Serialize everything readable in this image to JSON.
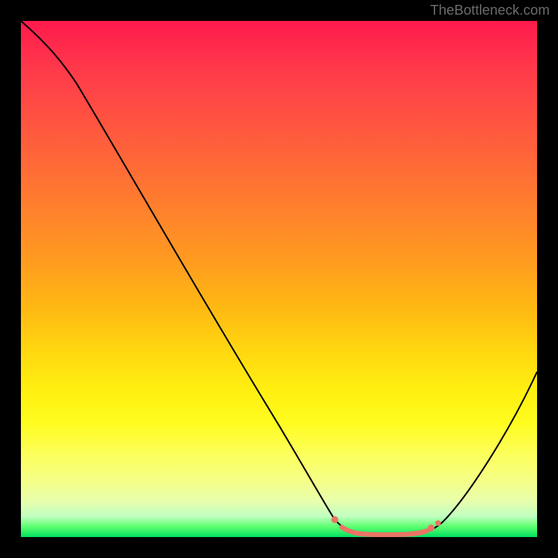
{
  "watermark": "TheBottleneck.com",
  "chart_data": {
    "type": "line",
    "title": "",
    "xlabel": "",
    "ylabel": "",
    "xlim": [
      0,
      100
    ],
    "ylim": [
      0,
      100
    ],
    "series": [
      {
        "name": "bottleneck-curve",
        "x": [
          0,
          5,
          10,
          15,
          20,
          25,
          30,
          35,
          40,
          45,
          50,
          55,
          60,
          62,
          65,
          68,
          72,
          75,
          78,
          80,
          83,
          86,
          90,
          95,
          100
        ],
        "values": [
          100,
          96,
          90,
          82,
          73,
          64,
          55,
          46,
          37,
          28,
          19,
          11,
          5,
          3,
          1,
          0.5,
          0.3,
          0.4,
          1,
          2,
          4,
          8,
          14,
          22,
          32
        ]
      }
    ],
    "valley_region": {
      "x_start": 60,
      "x_end": 80,
      "y": 0.5
    },
    "gradient_direction": "vertical",
    "gradient_stops": [
      {
        "pos": 0,
        "color": "#ff1a4d"
      },
      {
        "pos": 50,
        "color": "#ffba12"
      },
      {
        "pos": 80,
        "color": "#fffc20"
      },
      {
        "pos": 100,
        "color": "#00e060"
      }
    ]
  }
}
